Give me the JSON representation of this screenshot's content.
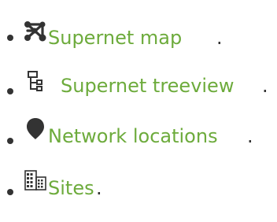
{
  "items": [
    {
      "label": "Supernet map",
      "icon": "network-map-icon",
      "suffix": "."
    },
    {
      "label": "Supernet treeview",
      "icon": "treeview-icon",
      "suffix": "."
    },
    {
      "label": "Network locations",
      "icon": "location-pin-icon",
      "suffix": "."
    },
    {
      "label": "Sites",
      "icon": "sites-building-icon",
      "suffix": "."
    }
  ],
  "colors": {
    "link": "#6dab3c",
    "text": "#333333"
  }
}
